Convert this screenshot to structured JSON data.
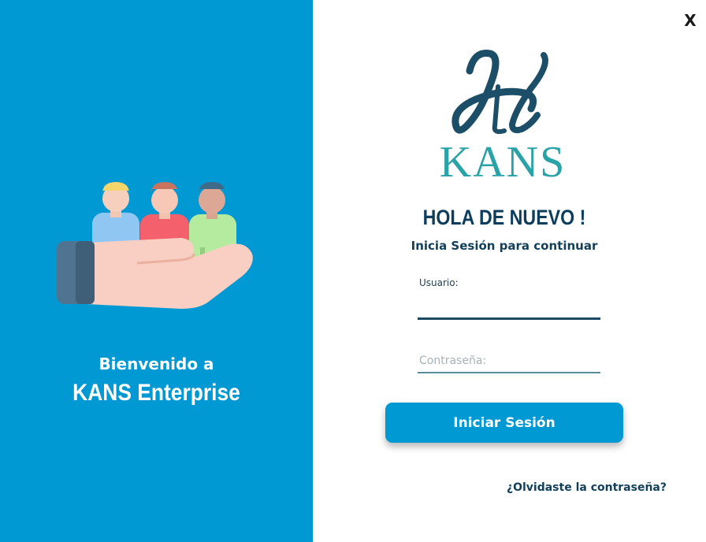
{
  "window": {
    "close_label": "X"
  },
  "sidebar": {
    "welcome_line1": "Bienvenido a",
    "welcome_line2": "KANS Enterprise",
    "illustration_icon": "hand-holding-people-icon",
    "background_color": "#0199d4"
  },
  "brand": {
    "logo_icon": "kans-h-monogram-icon",
    "logo_text": "KANS",
    "monogram_color": "#1c4f67",
    "text_color": "#2aa3a8"
  },
  "login": {
    "greeting": "HOLA DE NUEVO !",
    "subtitle": "Inicia Sesión para continuar",
    "username_label": "Usuario:",
    "username_value": "",
    "password_placeholder": "Contraseña:",
    "password_value": "",
    "submit_label": "Iniciar Sesión",
    "forgot_link": "¿Olvidaste la contraseña?",
    "accent_color": "#0199d4"
  }
}
